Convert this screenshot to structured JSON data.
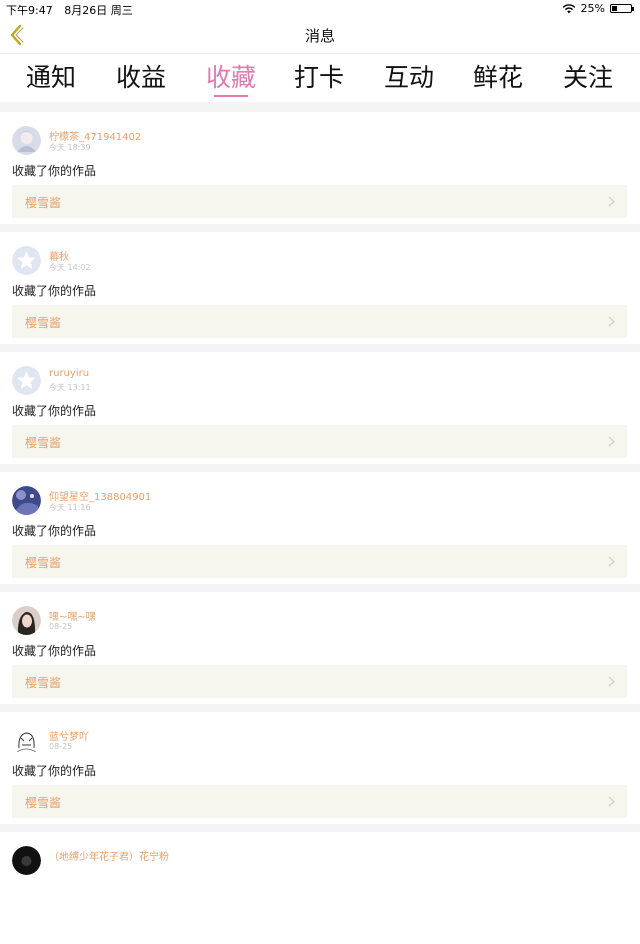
{
  "status": {
    "time": "下午9:47",
    "date": "8月26日 周三",
    "battery": "25%",
    "battery_level": 0.25
  },
  "nav": {
    "title": "消息"
  },
  "tabs": [
    {
      "label": "通知"
    },
    {
      "label": "收益"
    },
    {
      "label": "收藏",
      "active": true
    },
    {
      "label": "打卡"
    },
    {
      "label": "互动"
    },
    {
      "label": "鲜花"
    },
    {
      "label": "关注"
    }
  ],
  "notifications": [
    {
      "username": "柠檬茶_471941402",
      "time": "今天 18:39",
      "action": "收藏了你的作品",
      "work": "樱雪酱"
    },
    {
      "username": "幕秋",
      "time": "今天 14:02",
      "action": "收藏了你的作品",
      "work": "樱雪酱"
    },
    {
      "username": "ruruyiru",
      "time": "今天 13:11",
      "action": "收藏了你的作品",
      "work": "樱雪酱"
    },
    {
      "username": "仰望星空_138804901",
      "time": "今天 11:16",
      "action": "收藏了你的作品",
      "work": "樱雪酱"
    },
    {
      "username": "嘿~嘿~嘿",
      "time": "08-25",
      "action": "收藏了你的作品",
      "work": "樱雪酱"
    },
    {
      "username": "蓝兮梦吖",
      "time": "08-25",
      "action": "收藏了你的作品",
      "work": "樱雪酱"
    },
    {
      "username": "（地缚少年花子君）花宁粉",
      "time": "",
      "action": "",
      "work": ""
    }
  ],
  "colors": {
    "accent": "#e07bb0",
    "username": "#e8a06a",
    "work_box": "#f6f5ee"
  }
}
